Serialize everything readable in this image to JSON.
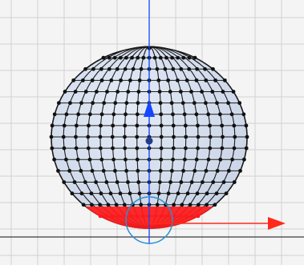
{
  "viewport": {
    "background": "#f4f4f4",
    "grid_color": "#d2d2d2",
    "axis_color": "#3a3a3a"
  },
  "sphere": {
    "fill": "#c9d4e6",
    "wire_color": "#1a1a1a",
    "vertex_color": "#111111",
    "selected_color": "#ff1a1a"
  },
  "gizmo": {
    "y_arrow_color": "#1646ff",
    "x_arrow_color": "#ff2a1a",
    "rotate_ring_color": "#2a8fd6",
    "pivot_color": "#1f3b8a",
    "icons": [
      "move-y-arrow-icon",
      "move-x-arrow-icon",
      "rotate-ring-icon",
      "pivot-icon"
    ]
  }
}
